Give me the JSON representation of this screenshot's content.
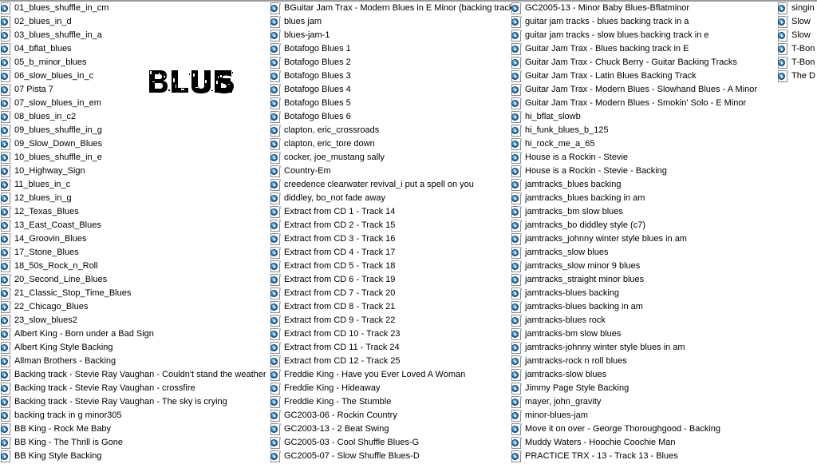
{
  "window": {
    "view_mode": "list",
    "background_color": "#ffffff",
    "text_color": "#000000"
  },
  "logo": {
    "text": "BLUES",
    "style": "grunge-stencil",
    "color": "#000000"
  },
  "icon": {
    "name": "media-file-icon",
    "disc_color": "#2d85c4",
    "page_color": "#fdfdfd"
  },
  "columns": [
    {
      "name": "column-1",
      "items": [
        "01_blues_shuffle_in_cm",
        "02_blues_in_d",
        "03_blues_shuffle_in_a",
        "04_bflat_blues",
        "05_b_minor_blues",
        "06_slow_blues_in_c",
        "07 Pista 7",
        "07_slow_blues_in_em",
        "08_blues_in_c2",
        "09_blues_shuffle_in_g",
        "09_Slow_Down_Blues",
        "10_blues_shuffle_in_e",
        "10_Highway_Sign",
        "11_blues_in_c",
        "12_blues_in_g",
        "12_Texas_Blues",
        "13_East_Coast_Blues",
        "14_Groovin_Blues",
        "17_Stone_Blues",
        "18_50s_Rock_n_Roll",
        "20_Second_Line_Blues",
        "21_Classic_Stop_Time_Blues",
        "22_Chicago_Blues",
        "23_slow_blues2",
        "Albert King - Born under a Bad Sign",
        "Albert King Style Backing",
        "Allman Brothers - Backing",
        "Backing track - Stevie Ray Vaughan - Couldn't stand the weather",
        "Backing track - Stevie Ray Vaughan - crossfire",
        "Backing track - Stevie Ray Vaughan - The sky is crying",
        "backing track in g minor305",
        "BB King - Rock Me Baby",
        "BB King - The Thrill is Gone",
        "BB King Style Backing"
      ]
    },
    {
      "name": "column-2",
      "items": [
        "BGuitar Jam Trax - Modern Blues in E Minor (backing track)",
        "blues jam",
        "blues-jam-1",
        "Botafogo Blues 1",
        "Botafogo Blues 2",
        "Botafogo Blues 3",
        "Botafogo Blues 4",
        "Botafogo Blues 5",
        "Botafogo Blues 6",
        "clapton, eric_crossroads",
        "clapton, eric_tore down",
        "cocker, joe_mustang sally",
        "Country-Em",
        "creedence clearwater revival_i put a spell on you",
        "diddley, bo_not fade away",
        "Extract from CD 1 - Track 14",
        "Extract from CD 2 - Track 15",
        "Extract from CD 3 - Track 16",
        "Extract from CD 4 - Track 17",
        "Extract from CD 5 - Track 18",
        "Extract from CD 6 - Track 19",
        "Extract from CD 7 - Track 20",
        "Extract from CD 8 - Track 21",
        "Extract from CD 9 - Track 22",
        "Extract from CD 10 - Track 23",
        "Extract from CD 11 - Track 24",
        "Extract from CD 12 - Track 25",
        "Freddie King - Have you Ever Loved A Woman",
        "Freddie King - Hideaway",
        "Freddie King - The Stumble",
        "GC2003-06 - Rockin Country",
        "GC2003-13 - 2 Beat Swing",
        "GC2005-03 - Cool Shuffle Blues-G",
        "GC2005-07 - Slow Shuffle Blues-D"
      ]
    },
    {
      "name": "column-3",
      "items": [
        "GC2005-13 - Minor Baby Blues-Bflatminor",
        "guitar jam tracks - blues backing track in a",
        "guitar jam tracks - slow blues backing track in e",
        "Guitar Jam Trax - Blues backing track in E",
        "Guitar Jam Trax - Chuck Berry - Guitar Backing Tracks",
        "Guitar Jam Trax - Latin Blues Backing Track",
        "Guitar Jam Trax - Modern Blues - Slowhand Blues - A Minor",
        "Guitar Jam Trax - Modern Blues - Smokin' Solo - E Minor",
        "hi_bflat_slowb",
        "hi_funk_blues_b_125",
        "hi_rock_me_a_65",
        "House is a Rockin - Stevie",
        "House is a Rockin - Stevie - Backing",
        "jamtracks_blues backing",
        "jamtracks_blues backing in am",
        "jamtracks_bm slow blues",
        "jamtracks_bo diddley style (c7)",
        "jamtracks_johnny winter style blues in am",
        "jamtracks_slow blues",
        "jamtracks_slow minor 9 blues",
        "jamtracks_straight minor blues",
        "jamtracks-blues backing",
        "jamtracks-blues backing in am",
        "jamtracks-blues rock",
        "jamtracks-bm slow blues",
        "jamtracks-johnny winter style blues in am",
        "jamtracks-rock n roll blues",
        "jamtracks-slow blues",
        "Jimmy Page Style Backing",
        "mayer, john_gravity",
        "minor-blues-jam",
        "Move it on over - George Thoroughgood - Backing",
        "Muddy Waters - Hoochie Coochie Man",
        "PRACTICE TRX - 13 - Track 13 - Blues"
      ]
    },
    {
      "name": "column-4",
      "clipped": true,
      "items": [
        "singin",
        "Slow ",
        "Slow ",
        "T-Bon",
        "T-Bon",
        "The D"
      ]
    }
  ]
}
